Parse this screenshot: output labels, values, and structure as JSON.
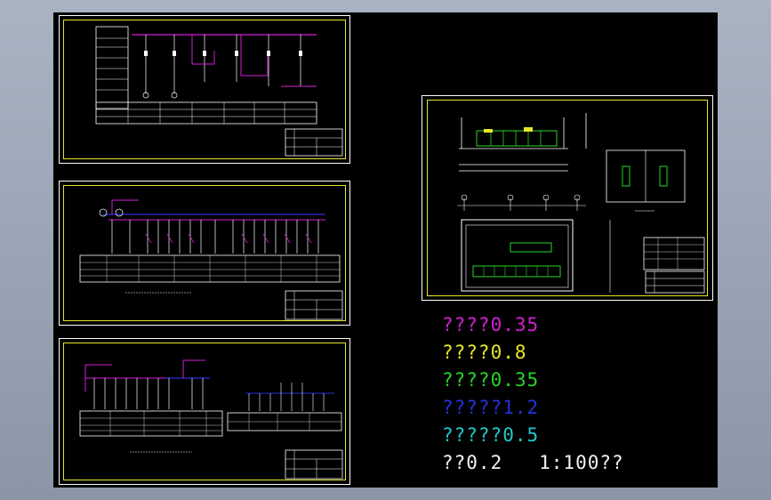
{
  "window": {
    "background_color": "#9aa5b6",
    "canvas_color": "#000000"
  },
  "sheets": [
    {
      "id": "schematic-1",
      "kind": "single-line-diagram"
    },
    {
      "id": "schematic-2",
      "kind": "single-line-diagram"
    },
    {
      "id": "schematic-3",
      "kind": "single-line-diagram"
    },
    {
      "id": "layout-plan",
      "kind": "floor-plan-and-section"
    }
  ],
  "legend": [
    {
      "text": "????0.35",
      "color": "#d21fd2"
    },
    {
      "text": "????0.8",
      "color": "#e6e62a"
    },
    {
      "text": "????0.35",
      "color": "#27d427"
    },
    {
      "text": "?????1.2",
      "color": "#2630d8"
    },
    {
      "text": "?????0.5",
      "color": "#1fc9c9"
    },
    {
      "text": "??0.2   1:100??",
      "color": "#f2f2f2"
    }
  ]
}
